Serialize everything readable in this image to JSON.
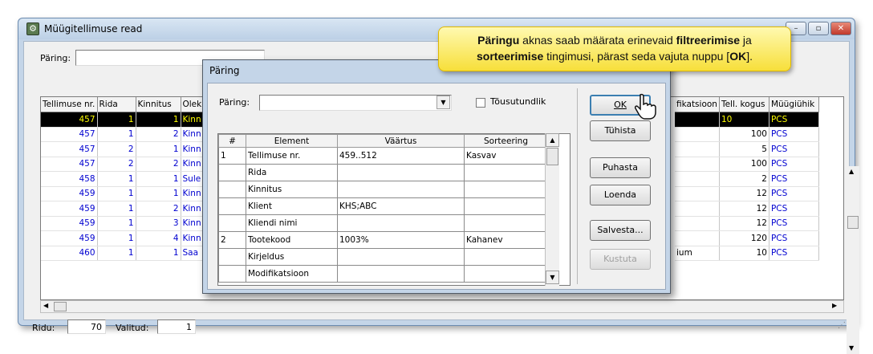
{
  "window": {
    "title": "Müügitellimuse read",
    "buttons": [
      "–",
      "▫",
      "✕"
    ]
  },
  "query_bar": {
    "label": "Päring:",
    "value": ""
  },
  "grid": {
    "columns_left": [
      "Tellimuse nr.",
      "Rida",
      "Kinnitus",
      "Olek"
    ],
    "columns_right": [
      "fikatsioon",
      "Tell. kogus",
      "Müügiühik"
    ],
    "rows": [
      {
        "order": "457",
        "line": "1",
        "confirm": "1",
        "status": "Kinn",
        "mod": "",
        "qty": "10",
        "unit": "PCS"
      },
      {
        "order": "457",
        "line": "1",
        "confirm": "2",
        "status": "Kinn",
        "mod": "",
        "qty": "100",
        "unit": "PCS"
      },
      {
        "order": "457",
        "line": "2",
        "confirm": "1",
        "status": "Kinn",
        "mod": "",
        "qty": "5",
        "unit": "PCS"
      },
      {
        "order": "457",
        "line": "2",
        "confirm": "2",
        "status": "Kinn",
        "mod": "",
        "qty": "100",
        "unit": "PCS"
      },
      {
        "order": "458",
        "line": "1",
        "confirm": "1",
        "status": "Sule",
        "mod": "",
        "qty": "2",
        "unit": "PCS"
      },
      {
        "order": "459",
        "line": "1",
        "confirm": "1",
        "status": "Kinn",
        "mod": "",
        "qty": "12",
        "unit": "PCS"
      },
      {
        "order": "459",
        "line": "1",
        "confirm": "2",
        "status": "Kinn",
        "mod": "",
        "qty": "12",
        "unit": "PCS"
      },
      {
        "order": "459",
        "line": "1",
        "confirm": "3",
        "status": "Kinn",
        "mod": "",
        "qty": "12",
        "unit": "PCS"
      },
      {
        "order": "459",
        "line": "1",
        "confirm": "4",
        "status": "Kinn",
        "mod": "",
        "qty": "120",
        "unit": "PCS"
      },
      {
        "order": "460",
        "line": "1",
        "confirm": "1",
        "status": "Saa",
        "mod": "ium",
        "qty": "10",
        "unit": "PCS"
      }
    ]
  },
  "statusbar": {
    "rows_label": "Ridu:",
    "rows_value": "70",
    "selected_label": "Valitud:",
    "selected_value": "1"
  },
  "dialog": {
    "title": "Päring",
    "query_label": "Päring:",
    "query_value": "",
    "ascending_label": "Tõusutundlik",
    "columns": [
      "#",
      "Element",
      "Väärtus",
      "Sorteering"
    ],
    "rows": [
      {
        "n": "1",
        "element": "Tellimuse nr.",
        "value": "459..512",
        "sort": "Kasvav"
      },
      {
        "n": "",
        "element": "Rida",
        "value": "",
        "sort": ""
      },
      {
        "n": "",
        "element": "Kinnitus",
        "value": "",
        "sort": ""
      },
      {
        "n": "",
        "element": "Klient",
        "value": "KHS;ABC",
        "sort": ""
      },
      {
        "n": "",
        "element": "Kliendi nimi",
        "value": "",
        "sort": ""
      },
      {
        "n": "2",
        "element": "Tootekood",
        "value": "1003%",
        "sort": "Kahanev"
      },
      {
        "n": "",
        "element": "Kirjeldus",
        "value": "",
        "sort": ""
      },
      {
        "n": "",
        "element": "Modifikatsioon",
        "value": "",
        "sort": ""
      }
    ],
    "buttons": {
      "ok": "OK",
      "cancel": "Tühista",
      "clear": "Puhasta",
      "read": "Loenda",
      "save": "Salvesta...",
      "delete": "Kustuta"
    }
  },
  "callout": {
    "part1_bold": "Päringu",
    "part2": " aknas saab määrata erinevaid ",
    "part3_bold": "filtreerimise",
    "part4": " ja ",
    "part5_bold": "sorteerimise",
    "part6": " tingimusi, pärast seda vajuta nuppu [",
    "part7_bold": "OK",
    "part8": "]."
  },
  "colors": {
    "accent_blue": "#0000d0",
    "selected_row_bg": "#000000",
    "selected_row_fg": "#ffff00",
    "callout_bg": "#f7df3a"
  }
}
